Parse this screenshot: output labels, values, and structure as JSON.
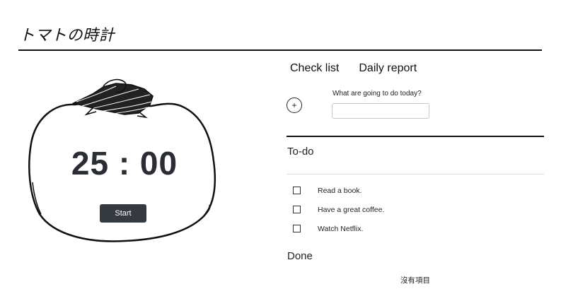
{
  "app": {
    "title": "トマトの時計"
  },
  "timer": {
    "display": "25 : 00",
    "start_label": "Start"
  },
  "tabs": [
    {
      "label": "Check list"
    },
    {
      "label": "Daily report"
    }
  ],
  "new_task": {
    "add_icon": "+",
    "label": "What are going to do today?",
    "value": "",
    "placeholder": ""
  },
  "todo": {
    "title": "To-do",
    "items": [
      {
        "text": "Read a book.",
        "checked": false
      },
      {
        "text": "Have a great coffee.",
        "checked": false
      },
      {
        "text": "Watch Netflix.",
        "checked": false
      }
    ]
  },
  "done": {
    "title": "Done",
    "empty_text": "沒有項目"
  },
  "colors": {
    "start_button": "#343a40",
    "timer_text": "#2a2d33",
    "rule": "#111111"
  }
}
